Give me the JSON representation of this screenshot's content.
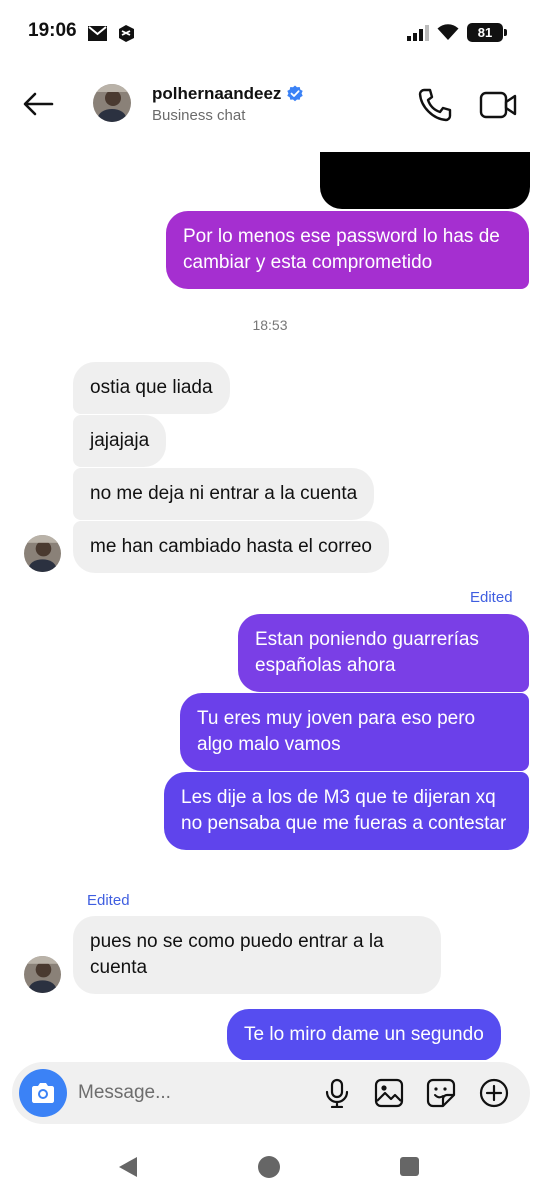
{
  "status": {
    "time": "19:06",
    "battery": "81"
  },
  "header": {
    "name": "polhernaandeez",
    "subtitle": "Business chat"
  },
  "chat": {
    "timestamp": "18:53",
    "edited_label": "Edited",
    "messages": [
      {
        "dir": "out",
        "text": "Por lo menos ese password lo has de cambiar y esta comprometido",
        "color": "#a52fd0"
      },
      {
        "dir": "in",
        "text": "ostia que liada"
      },
      {
        "dir": "in",
        "text": "jajajaja"
      },
      {
        "dir": "in",
        "text": "no me deja ni entrar a la cuenta"
      },
      {
        "dir": "in",
        "text": "me han cambiado hasta el correo"
      },
      {
        "dir": "out",
        "text": "Estan poniendo guarrerías españolas ahora",
        "color": "#7a3fe6"
      },
      {
        "dir": "out",
        "text": "Tu eres muy joven para eso pero algo malo vamos",
        "color": "#6b40ea"
      },
      {
        "dir": "out",
        "text": "Les dije a los de M3 que te dijeran xq no pensaba que me fueras a contestar",
        "color": "#5f44ec"
      },
      {
        "dir": "in",
        "text": "pues no se como puedo entrar a la cuenta"
      },
      {
        "dir": "out",
        "text": "Te lo miro dame un segundo",
        "color": "#564df0"
      }
    ]
  },
  "composer": {
    "placeholder": "Message..."
  },
  "icons": {
    "back": "arrow-left-icon",
    "verified": "verified-badge-icon",
    "call": "phone-icon",
    "video": "video-camera-icon",
    "camera": "camera-icon",
    "mic": "microphone-icon",
    "gallery": "image-icon",
    "sticker": "sticker-icon",
    "plus": "plus-circle-icon"
  },
  "colors": {
    "accent": "#3b82f6",
    "edited": "#3f5ee0",
    "incoming_bubble": "#efefef"
  }
}
